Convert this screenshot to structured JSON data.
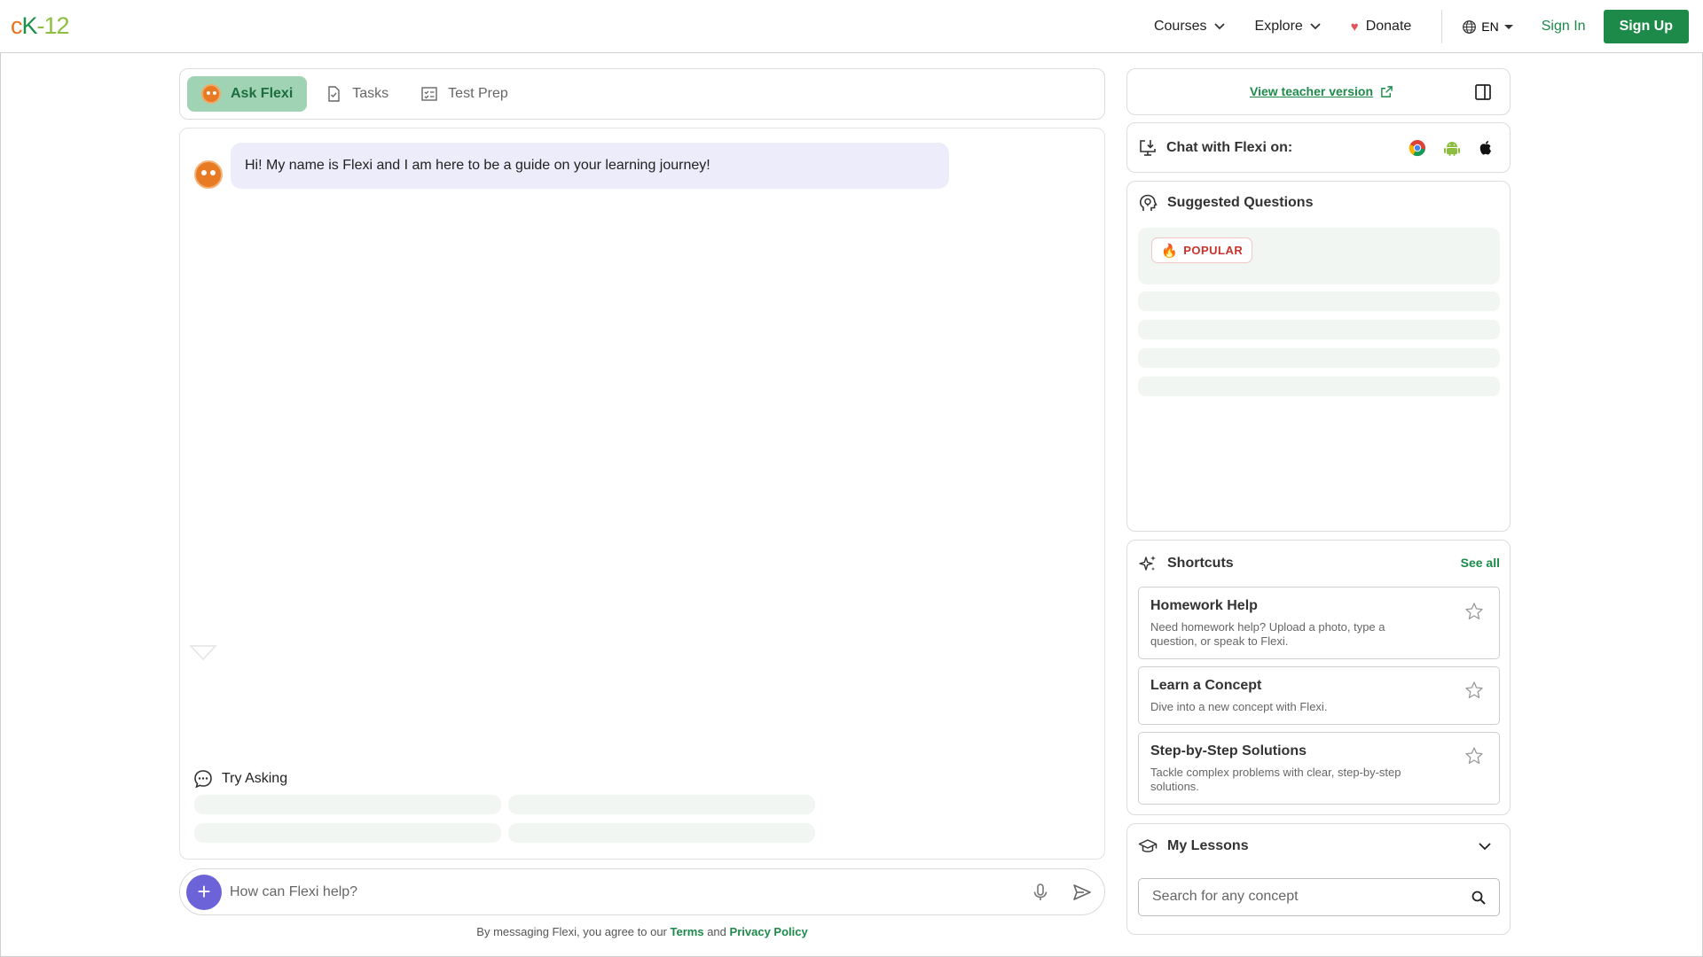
{
  "header": {
    "logo": {
      "c": "c",
      "k": "K",
      "dash": "-",
      "num": "12"
    },
    "nav": {
      "courses": "Courses",
      "explore": "Explore",
      "donate": "Donate",
      "language": "EN",
      "sign_in": "Sign In",
      "sign_up": "Sign Up"
    }
  },
  "tabs": [
    {
      "label": "Ask Flexi",
      "active": true
    },
    {
      "label": "Tasks",
      "active": false
    },
    {
      "label": "Test Prep",
      "active": false
    }
  ],
  "chat": {
    "greeting": "Hi! My name is Flexi and I am here to be a guide on your learning journey!",
    "try_asking": "Try Asking",
    "input_placeholder": "How can Flexi help?",
    "disclaimer": {
      "prefix": "By messaging Flexi, you agree to our",
      "terms": "Terms",
      "and": "and",
      "privacy": "Privacy Policy"
    }
  },
  "sidebar": {
    "teacher_link": "View teacher version",
    "chat_on": "Chat with Flexi on:",
    "platforms": [
      "chrome-icon",
      "android-icon",
      "apple-icon"
    ],
    "suggested": {
      "title": "Suggested Questions",
      "badge": "POPULAR"
    },
    "shortcuts": {
      "title": "Shortcuts",
      "see_all": "See all",
      "items": [
        {
          "title": "Homework Help",
          "description": "Need homework help? Upload a photo, type a question, or speak to Flexi."
        },
        {
          "title": "Learn a Concept",
          "description": "Dive into a new concept with Flexi."
        },
        {
          "title": "Step-by-Step Solutions",
          "description": "Tackle complex problems with clear, step-by-step solutions."
        }
      ]
    },
    "lessons": {
      "title": "My Lessons",
      "search_placeholder": "Search for any concept"
    }
  },
  "colors": {
    "brand_green": "#1d8a4a",
    "flexi_orange": "#e87a24",
    "accent_purple": "#6d63d9",
    "bubble_bg": "#ececfa",
    "skeleton": "#f1f6f3"
  }
}
